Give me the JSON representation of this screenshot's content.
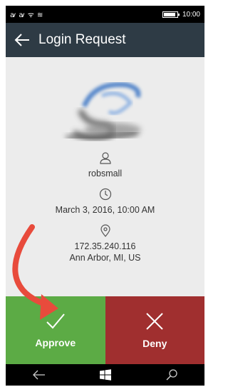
{
  "status_bar": {
    "left_icons": "ꜹ ꜹ ᯤ ≋",
    "time": "10:00"
  },
  "header": {
    "title": "Login Request"
  },
  "details": {
    "username": "robsmall",
    "datetime": "March 3, 2016, 10:00 AM",
    "ip": "172.35.240.116",
    "location": "Ann Arbor, MI, US"
  },
  "actions": {
    "approve_label": "Approve",
    "deny_label": "Deny"
  },
  "icons": {
    "back": "back-arrow-icon",
    "user": "user-icon",
    "clock": "clock-icon",
    "location": "location-pin-icon",
    "approve": "checkmark-icon",
    "deny": "x-icon",
    "nav_back": "back-icon",
    "nav_start": "windows-icon",
    "nav_search": "search-icon"
  },
  "colors": {
    "header": "#2e3b45",
    "approve": "#5cab45",
    "deny": "#a02f2f",
    "annotation_arrow": "#e84b3c"
  }
}
